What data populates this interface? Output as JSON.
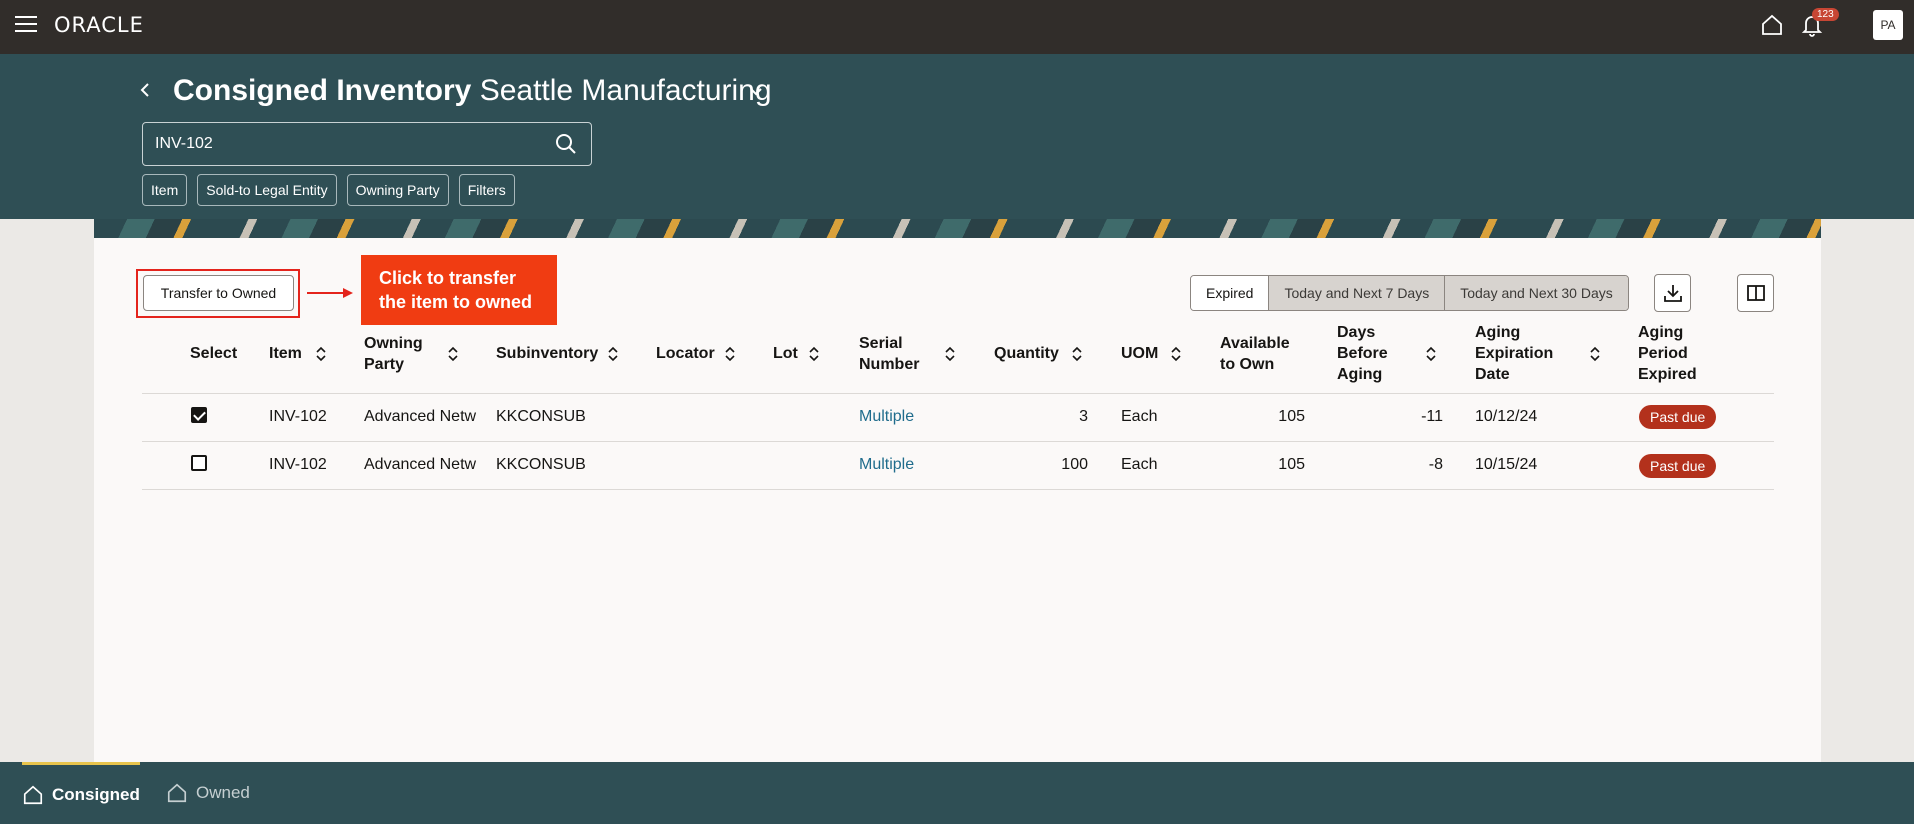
{
  "app": {
    "logo": "ORACLE",
    "notification_count": "123",
    "avatar_initials": "PA"
  },
  "header": {
    "title": "Consigned Inventory",
    "subtitle": "Seattle Manufacturing",
    "search_value": "INV-102",
    "filter_chips": [
      "Item",
      "Sold-to Legal Entity",
      "Owning Party",
      "Filters"
    ]
  },
  "toolbar": {
    "transfer_label": "Transfer to Owned",
    "callout_text": "Click to transfer the item to owned",
    "segments": [
      "Expired",
      "Today and Next 7 Days",
      "Today and Next 30 Days"
    ],
    "selected_segment": "Expired"
  },
  "table": {
    "columns": [
      "Select",
      "Item",
      "Owning Party",
      "Subinventory",
      "Locator",
      "Lot",
      "Serial Number",
      "Quantity",
      "UOM",
      "Available to Own",
      "Days Before Aging",
      "Aging Expiration Date",
      "Aging Period Expired"
    ],
    "rows": [
      {
        "selected": true,
        "item": "INV-102",
        "owning_party": "Advanced Netw",
        "subinventory": "KKCONSUB",
        "locator": "",
        "lot": "",
        "serial": "Multiple",
        "quantity": "3",
        "uom": "Each",
        "available": "105",
        "days_before": "-11",
        "expiration": "10/12/24",
        "status": "Past due"
      },
      {
        "selected": false,
        "item": "INV-102",
        "owning_party": "Advanced Netw",
        "subinventory": "KKCONSUB",
        "locator": "",
        "lot": "",
        "serial": "Multiple",
        "quantity": "100",
        "uom": "Each",
        "available": "105",
        "days_before": "-8",
        "expiration": "10/15/24",
        "status": "Past due"
      }
    ]
  },
  "bottom_nav": {
    "tabs": [
      {
        "label": "Consigned",
        "active": true
      },
      {
        "label": "Owned",
        "active": false
      }
    ]
  },
  "colors": {
    "header_bg": "#2f4f55",
    "topbar_bg": "#312d2a",
    "callout": "#f03c12",
    "pill": "#b3311c",
    "link": "#1f6c8c"
  },
  "icons": [
    "hamburger-icon",
    "home-icon",
    "bell-icon",
    "back-icon",
    "chevron-down-icon",
    "search-icon",
    "arrow-right-icon",
    "download-icon",
    "columns-icon",
    "sort-icon"
  ]
}
